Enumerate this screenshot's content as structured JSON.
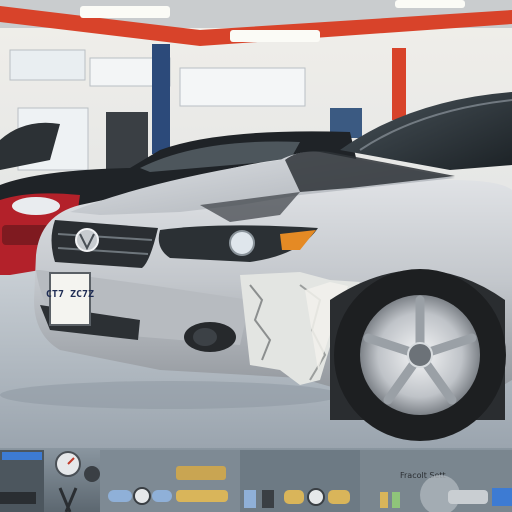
{
  "photo": {
    "subject": "damaged-silver-sedan-in-repair-garage",
    "license_plate": "CT7 ZC7Z",
    "toolbar_strip": {
      "panel_label": "Fracolt Sett"
    }
  },
  "colors": {
    "car_silver": "#c9ccd1",
    "garage_wall": "#eceae4",
    "ceiling_beam": "#d8432a",
    "floor": "#b8c0c8",
    "red_car": "#b3212a",
    "windshield": "#2a3136",
    "tire": "#1d1f21",
    "toolbar_bg": "#6f7c86",
    "toolbar_accent_blue": "#8fb0d8",
    "toolbar_accent_yellow": "#d9b55a"
  },
  "icons": [
    "gauge-icon",
    "wrench-icon",
    "toggle-icon",
    "button-icon"
  ]
}
